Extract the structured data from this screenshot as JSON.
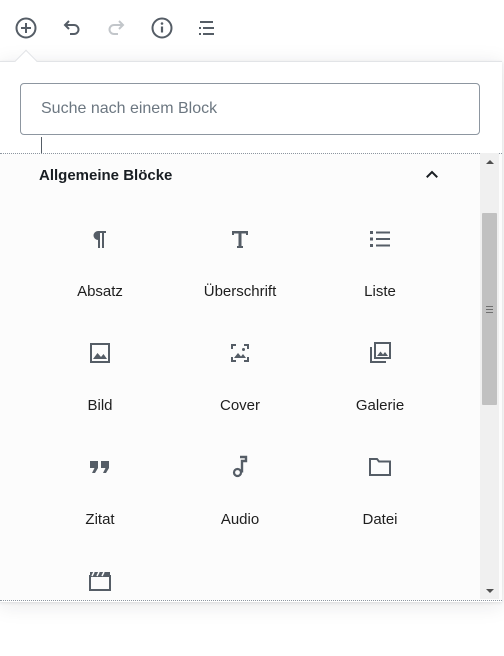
{
  "toolbar": {
    "buttons": [
      {
        "name": "add-block-icon"
      },
      {
        "name": "undo-icon"
      },
      {
        "name": "redo-icon"
      },
      {
        "name": "info-icon"
      },
      {
        "name": "block-navigation-icon"
      }
    ]
  },
  "search": {
    "placeholder": "Suche nach einem Block"
  },
  "panel": {
    "title": "Allgemeine Blöcke",
    "toggle_icon": "chevron-up-icon"
  },
  "blocks": [
    {
      "label": "Absatz",
      "icon": "paragraph-icon"
    },
    {
      "label": "Überschrift",
      "icon": "heading-icon"
    },
    {
      "label": "Liste",
      "icon": "list-icon"
    },
    {
      "label": "Bild",
      "icon": "image-icon"
    },
    {
      "label": "Cover",
      "icon": "cover-icon"
    },
    {
      "label": "Galerie",
      "icon": "gallery-icon"
    },
    {
      "label": "Zitat",
      "icon": "quote-icon"
    },
    {
      "label": "Audio",
      "icon": "audio-icon"
    },
    {
      "label": "Datei",
      "icon": "file-icon"
    },
    {
      "label": "",
      "icon": "video-icon"
    }
  ],
  "colors": {
    "icon": "#555d66",
    "text": "#1e1e1e",
    "border": "#8d96a0"
  }
}
